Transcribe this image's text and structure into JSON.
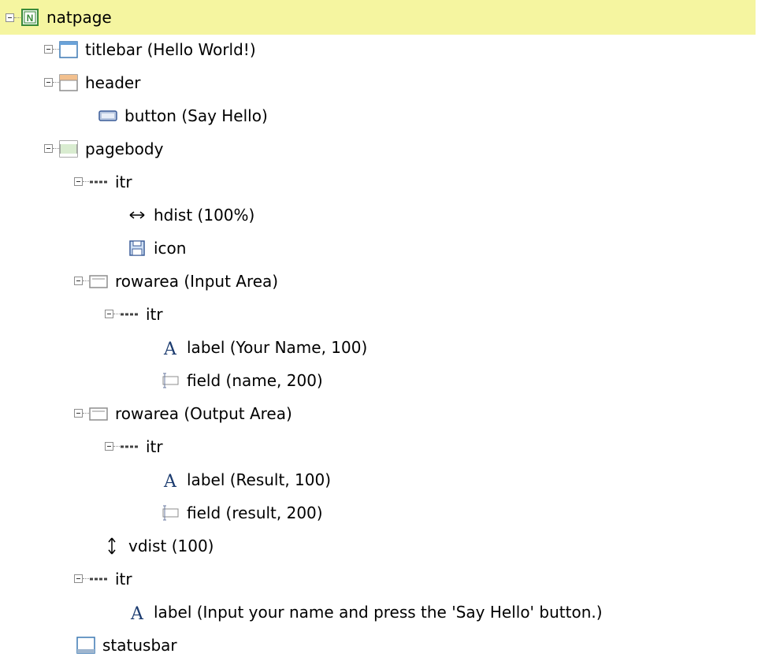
{
  "tree": {
    "root": {
      "label": "natpage",
      "icon": "natpage-icon",
      "expanded": true,
      "selected": true
    },
    "nodes": [
      {
        "label": "titlebar (Hello World!)",
        "icon": "titlebar-icon"
      },
      {
        "label": "header",
        "icon": "header-icon"
      },
      {
        "label": "button (Say Hello)",
        "icon": "button-icon"
      },
      {
        "label": "pagebody",
        "icon": "pagebody-icon"
      },
      {
        "label": "itr",
        "icon": "itr-icon"
      },
      {
        "label": "hdist (100%)",
        "icon": "hdist-icon"
      },
      {
        "label": "icon",
        "icon": "icon-icon"
      },
      {
        "label": "rowarea (Input Area)",
        "icon": "rowarea-icon"
      },
      {
        "label": "itr",
        "icon": "itr-icon"
      },
      {
        "label": "label (Your Name, 100)",
        "icon": "label-icon"
      },
      {
        "label": "field (name, 200)",
        "icon": "field-icon"
      },
      {
        "label": "rowarea (Output Area)",
        "icon": "rowarea-icon"
      },
      {
        "label": "itr",
        "icon": "itr-icon"
      },
      {
        "label": "label (Result, 100)",
        "icon": "label-icon"
      },
      {
        "label": "field (result, 200)",
        "icon": "field-icon"
      },
      {
        "label": "vdist (100)",
        "icon": "vdist-icon"
      },
      {
        "label": "itr",
        "icon": "itr-icon"
      },
      {
        "label": "label (Input your name and press the 'Say Hello' button.)",
        "icon": "label-icon"
      },
      {
        "label": "statusbar",
        "icon": "statusbar-icon"
      }
    ]
  },
  "colors": {
    "selection": "#f5f5a0",
    "natpage_icon": "#3a8a3a",
    "window_blue": "#3c78b4"
  }
}
